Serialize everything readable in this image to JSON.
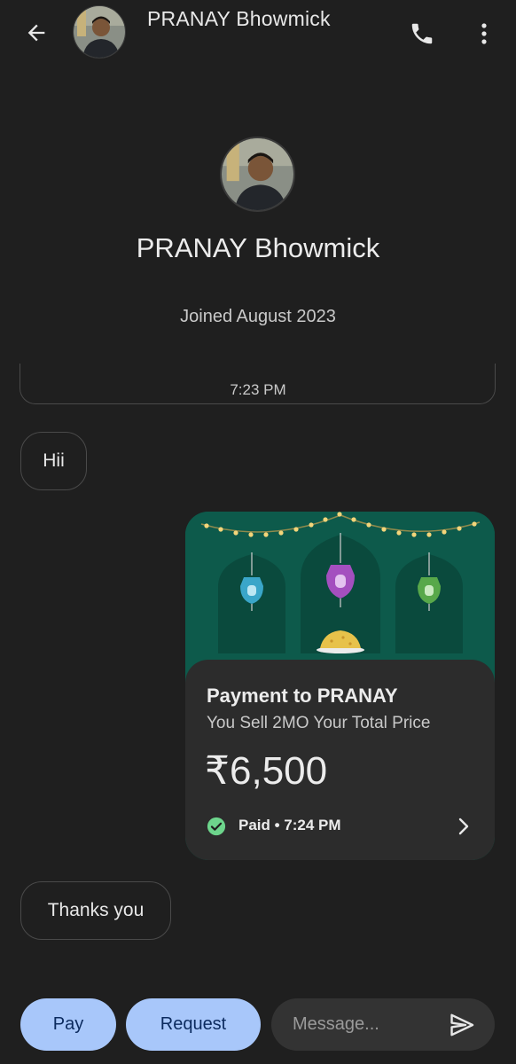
{
  "header": {
    "contact_name": "PRANAY Bhowmick",
    "back_icon": "arrow-left-icon",
    "call_icon": "phone-icon",
    "more_icon": "more-vert-icon"
  },
  "profile": {
    "name": "PRANAY Bhowmick",
    "joined": "Joined August 2023"
  },
  "conversation": {
    "divider_time": "7:23 PM",
    "messages": [
      {
        "direction": "incoming",
        "text": "Hii"
      },
      {
        "direction": "incoming",
        "text": "Thanks you"
      }
    ]
  },
  "payment_card": {
    "title": "Payment to PRANAY",
    "note": "You Sell 2MO Your Total Price",
    "amount": "₹6,500",
    "status": "Paid • 7:24 PM",
    "status_icon": "check-circle-icon",
    "chevron_icon": "chevron-right-icon",
    "banner_theme": "lanterns-and-lights",
    "colors": {
      "banner": "#0d5a4b",
      "paid": "#6dd58c"
    }
  },
  "composer": {
    "pay_label": "Pay",
    "request_label": "Request",
    "placeholder": "Message...",
    "send_icon": "send-icon"
  },
  "colors": {
    "background": "#1f1f1f",
    "accent_button": "#a8c7fa",
    "accent_button_text": "#0b2a5e"
  }
}
